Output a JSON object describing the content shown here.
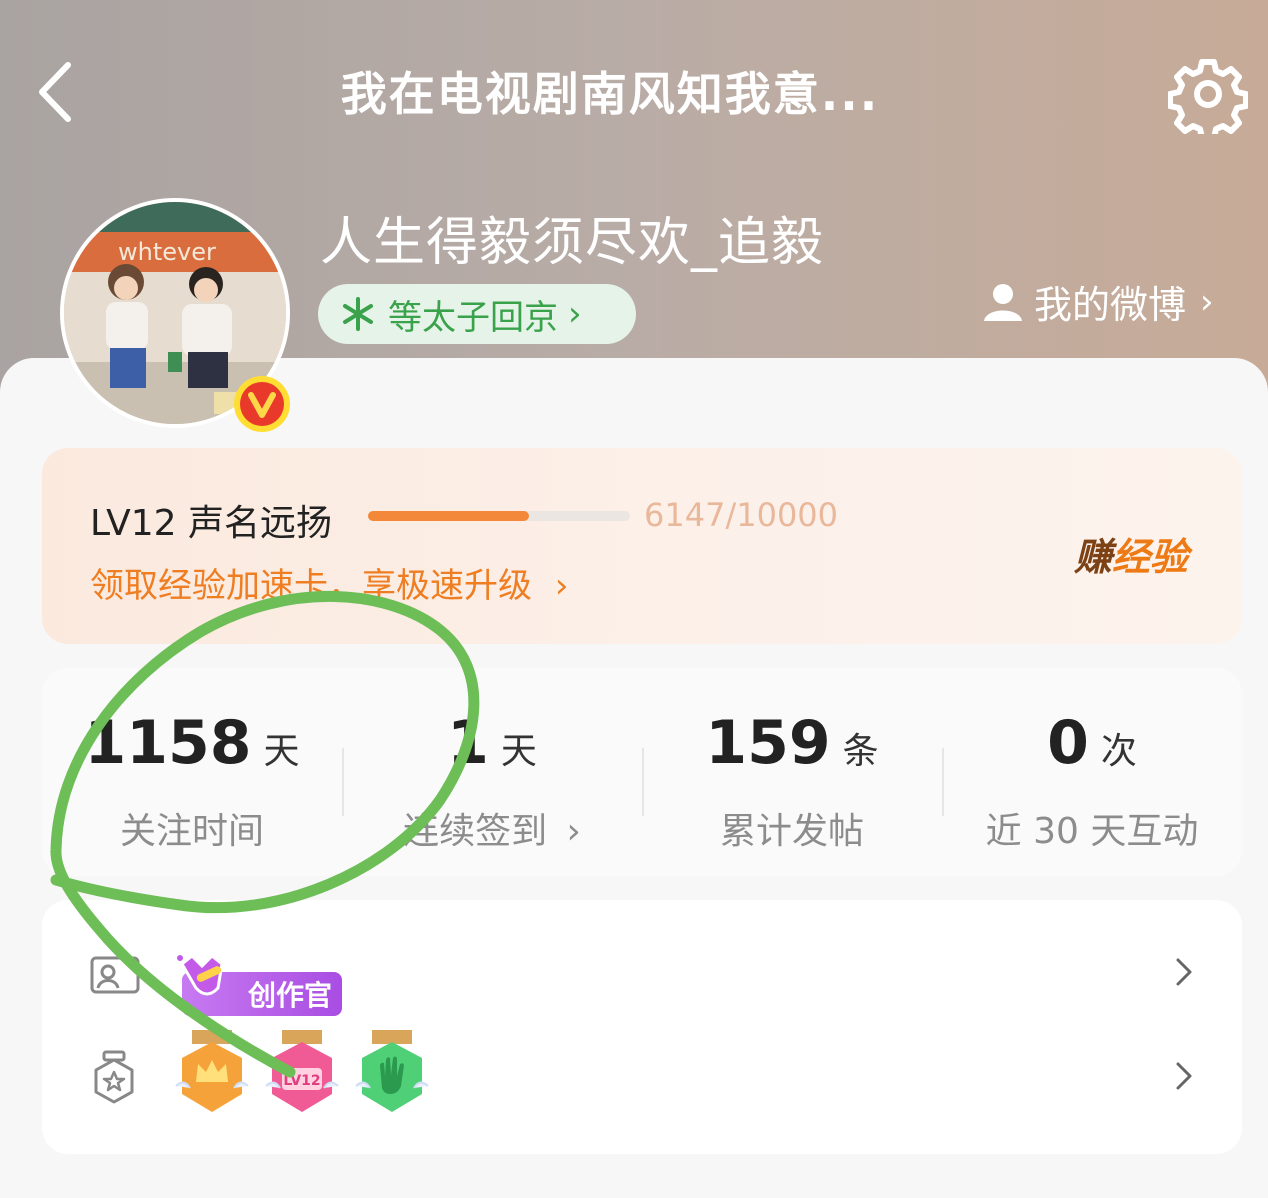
{
  "header": {
    "title": "我在电视剧南风知我意...",
    "username": "人生得毅须尽欢_追毅",
    "fan_tag": "等太子回京",
    "my_weibo_label": "我的微博",
    "colors": {
      "gradient_left": "#a9a3a1",
      "gradient_right": "#c7ab98"
    }
  },
  "avatar": {
    "sign_text": "whtever"
  },
  "level": {
    "title": "LV12 声名远扬",
    "progress_text": "6147/10000",
    "progress": 0.6147,
    "promo_link": "领取经验加速卡，享极速升级",
    "earn_label_a": "赚",
    "earn_label_b": "经验",
    "accent": "#f4883a"
  },
  "stats": [
    {
      "value": "1158",
      "unit": "天",
      "label": "关注时间"
    },
    {
      "value": "1",
      "unit": "天",
      "label": "连续签到"
    },
    {
      "value": "159",
      "unit": "条",
      "label": "累计发帖"
    },
    {
      "value": "0",
      "unit": "次",
      "label": "近 30 天互动"
    }
  ],
  "badges": {
    "creator_label": "创作官",
    "medal_lv_label": "LV12"
  },
  "annotation": {
    "color": "#6dbe57"
  }
}
